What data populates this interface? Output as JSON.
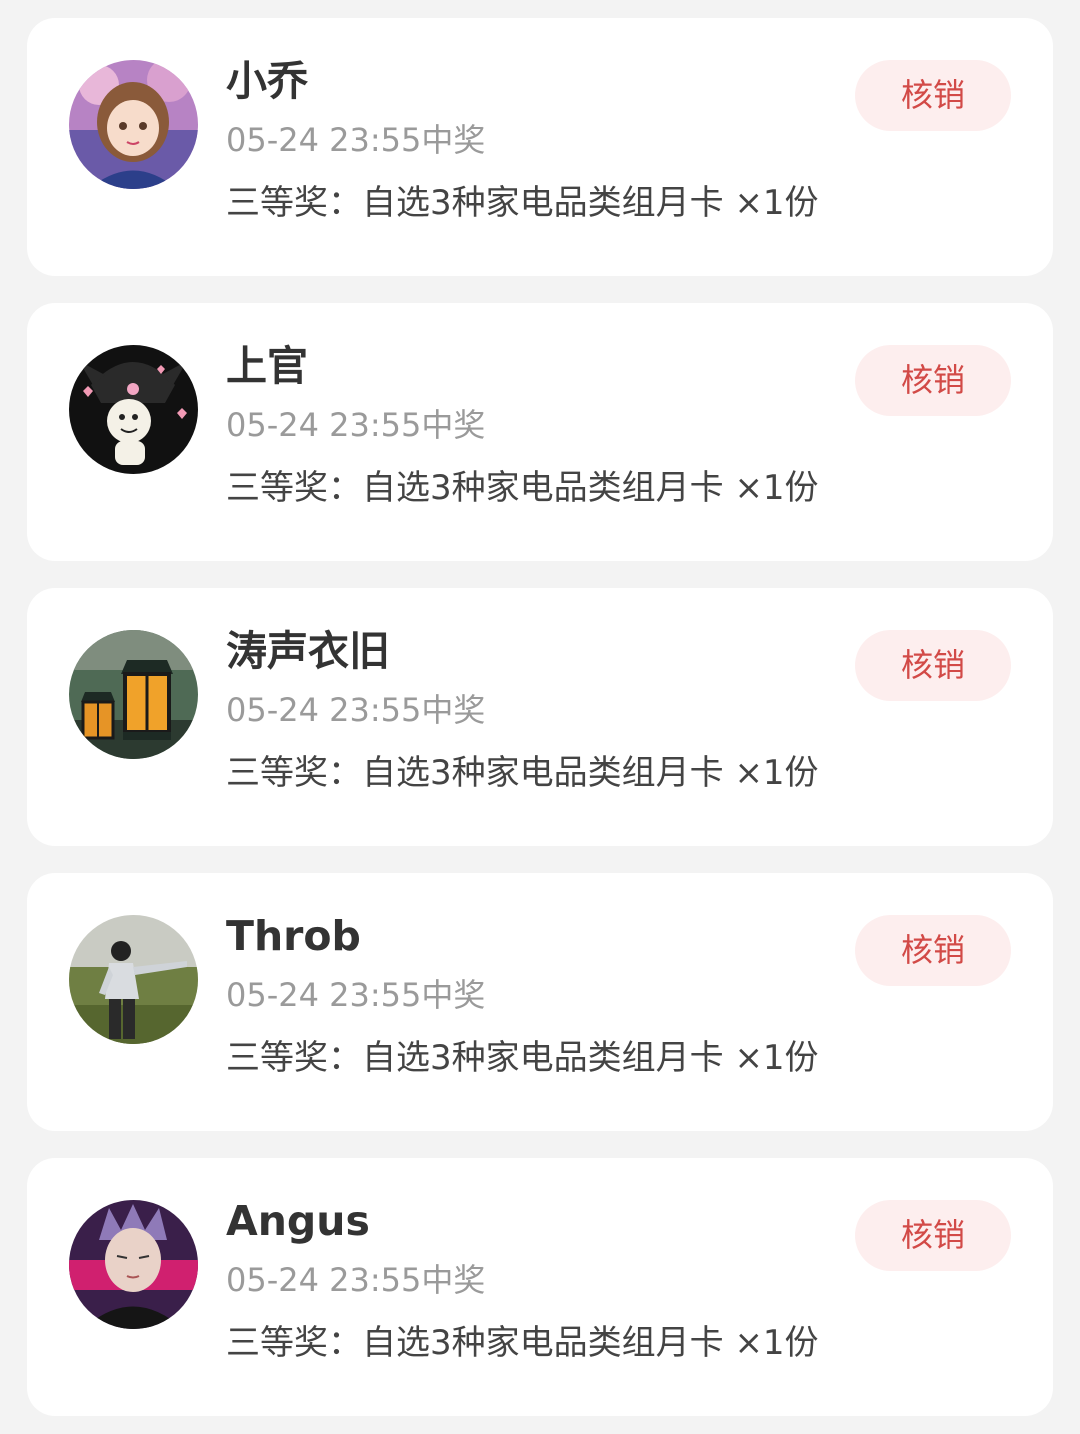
{
  "records": [
    {
      "name": "小乔",
      "time": "05-24 23:55中奖",
      "prize": "三等奖：自选3种家电品类组月卡 ×1份",
      "action_label": "核销",
      "avatar_icon": "anime-girl-avatar-icon"
    },
    {
      "name": "上官",
      "time": "05-24 23:55中奖",
      "prize": "三等奖：自选3种家电品类组月卡 ×1份",
      "action_label": "核销",
      "avatar_icon": "kuromi-avatar-icon"
    },
    {
      "name": "涛声衣旧",
      "time": "05-24 23:55中奖",
      "prize": "三等奖：自选3种家电品类组月卡 ×1份",
      "action_label": "核销",
      "avatar_icon": "lantern-avatar-icon"
    },
    {
      "name": "Throb",
      "time": "05-24 23:55中奖",
      "prize": "三等奖：自选3种家电品类组月卡 ×1份",
      "action_label": "核销",
      "avatar_icon": "person-in-field-avatar-icon"
    },
    {
      "name": "Angus",
      "time": "05-24 23:55中奖",
      "prize": "三等奖：自选3种家电品类组月卡 ×1份",
      "action_label": "核销",
      "avatar_icon": "anime-man-avatar-icon"
    }
  ],
  "colors": {
    "page_background": "#f3f3f3",
    "card_background": "#ffffff",
    "button_background": "#fdeeee",
    "button_text": "#d24a47",
    "name_text": "#333333",
    "time_text": "#9a9a9a",
    "prize_text": "#444444"
  }
}
